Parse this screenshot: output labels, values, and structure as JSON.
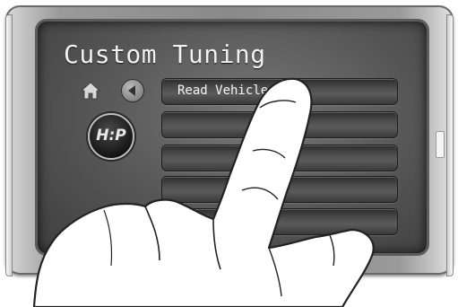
{
  "screen": {
    "title": "Custom Tuning",
    "icons": [
      "home-icon",
      "back-icon"
    ],
    "logo_text": "H:P"
  },
  "menu": {
    "items": [
      {
        "label": "Read Vehicle"
      },
      {
        "label": ""
      },
      {
        "label": ""
      },
      {
        "label": ""
      },
      {
        "label": ""
      }
    ]
  },
  "colors": {
    "bezel": "#8a8a8a",
    "screen": "#555555",
    "text": "#f2f2f2"
  }
}
